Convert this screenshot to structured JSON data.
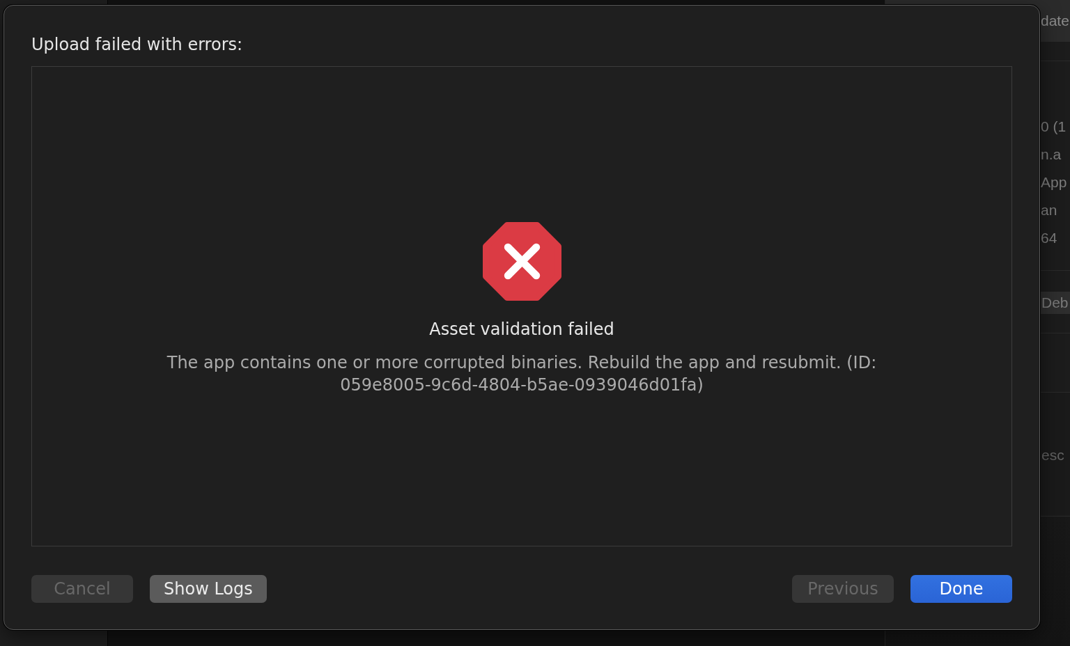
{
  "dialog": {
    "title": "Upload failed with errors:",
    "result": {
      "kind": "error",
      "heading": "Asset validation failed",
      "message": "The app contains one or more corrupted binaries. Rebuild the app and resubmit. (ID: 059e8005-9c6d-4804-b5ae-0939046d01fa)"
    },
    "left_buttons": [
      {
        "label": "Cancel",
        "disabled": true,
        "kind": "default"
      },
      {
        "label": "Show Logs",
        "disabled": false,
        "kind": "default"
      }
    ],
    "right_buttons": [
      {
        "label": "Previous",
        "disabled": true,
        "kind": "default"
      },
      {
        "label": "Done",
        "disabled": false,
        "kind": "primary"
      }
    ]
  },
  "background_window": {
    "header_title": "date",
    "info_rows": [
      "0 (1",
      "n.a",
      "App",
      "an",
      "64"
    ],
    "button": "Deb",
    "text_area": {
      "placeholder": "esc"
    }
  }
}
